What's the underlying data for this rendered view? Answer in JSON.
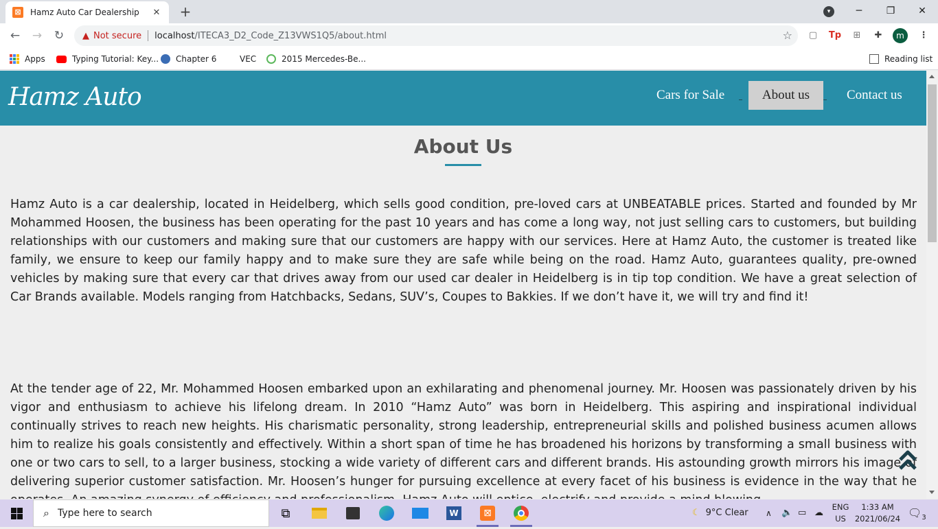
{
  "browser": {
    "tab_title": "Hamz Auto Car Dealership",
    "tab_favicon": "xampp-icon",
    "new_tab": "+",
    "security_label": "Not secure",
    "url_host": "localhost",
    "url_path": "/ITECA3_D2_Code_Z13VWS1Q5/about.html",
    "profile_initial": "m",
    "bookmarks": [
      "Apps",
      "Typing Tutorial: Key...",
      "Chapter 6",
      "VEC",
      "2015 Mercedes-Be..."
    ],
    "reading_list": "Reading list"
  },
  "site": {
    "logo": "Hamz Auto",
    "nav": [
      "Cars for Sale",
      "About us",
      "Contact us"
    ],
    "active_nav": "About us",
    "brand_color": "#288ea8",
    "heading": "About Us",
    "paragraph1": "Hamz Auto is a car dealership, located in Heidelberg, which sells good condition, pre-loved cars at UNBEATABLE prices. Started and founded by Mr Mohammed Hoosen, the business has been operating for the past 10 years and has come a long way, not just selling cars to customers, but building relationships with our customers and making sure that our customers are happy with our services. Here at Hamz Auto, the customer is treated like family, we ensure to keep our family happy and to make sure they are safe while being on the road. Hamz Auto, guarantees quality, pre-owned vehicles by making sure that every car that drives away from our used car dealer in Heidelberg is in tip top condition. We have a great selection of Car Brands available. Models ranging from Hatchbacks, Sedans, SUV’s, Coupes to Bakkies. If we don’t have it, we will try and find it!",
    "paragraph2": "At the tender age of 22, Mr. Mohammed Hoosen embarked upon an exhilarating and phenomenal journey. Mr. Hoosen was passionately driven by his vigor and enthusiasm to achieve his lifelong dream. In 2010 “Hamz Auto” was born in Heidelberg. This aspiring and inspirational individual continually strives to reach new heights. His charismatic personality, strong leadership, entrepreneurial skills and polished business acumen allows him to realize his goals consistently and effectively. Within a short span of time he has broadened his horizons by transforming a small business with one or two cars to sell, to a larger business, stocking a wide variety of different cars and different brands. His astounding growth mirrors his image of delivering superior customer satisfaction. Mr. Hoosen’s hunger for pursuing excellence at every facet of his business is evidence in the way that he operates. An amazing synergy of efficiency and professionalism, Hamz Auto will entice, electrify and provide a mind blowing"
  },
  "taskbar": {
    "search_placeholder": "Type here to search",
    "weather": "9°C  Clear",
    "lang_top": "ENG",
    "lang_bottom": "US",
    "time": "1:33 AM",
    "date": "2021/06/24",
    "notification_count": "3"
  }
}
